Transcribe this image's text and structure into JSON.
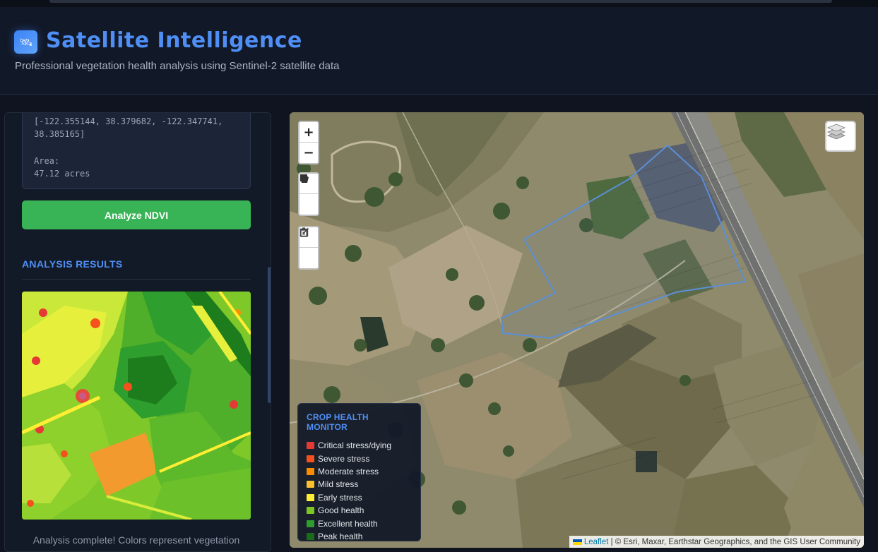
{
  "header": {
    "title": "Satellite Intelligence",
    "subtitle": "Professional vegetation health analysis using Sentinel-2 satellite data",
    "logo_icon": "satellite-icon"
  },
  "sidebar": {
    "bbox_text": "[-122.355144, 38.379682, -122.347741, 38.385165]",
    "area_label": "Area:",
    "area_value": "47.12 acres",
    "analyze_button": "Analyze NDVI",
    "results_title": "ANALYSIS RESULTS",
    "analysis_text": "Analysis complete! Colors represent vegetation"
  },
  "map": {
    "zoom_in": "+",
    "zoom_out": "−",
    "draw_tools": [
      "draw-polygon-icon",
      "draw-rectangle-icon",
      "edit-layers-icon",
      "delete-layers-icon"
    ],
    "layers_icon": "layers-icon",
    "attribution_link": "Leaflet",
    "attribution_text": "| © Esri, Maxar, Earthstar Geographics, and the GIS User Community"
  },
  "legend": {
    "title": "CROP HEALTH MONITOR",
    "items": [
      {
        "label": "Critical stress/dying",
        "color": "#e53935"
      },
      {
        "label": "Severe stress",
        "color": "#f4511e"
      },
      {
        "label": "Moderate stress",
        "color": "#fb8c00"
      },
      {
        "label": "Mild stress",
        "color": "#fbc02d"
      },
      {
        "label": "Early stress",
        "color": "#ffee33"
      },
      {
        "label": "Good health",
        "color": "#7cc623"
      },
      {
        "label": "Excellent health",
        "color": "#2e9e2e"
      },
      {
        "label": "Peak health",
        "color": "#1b6b1b"
      }
    ]
  },
  "colors": {
    "accent": "#4f8ff5",
    "button": "#38b356",
    "background": "#0f1420"
  }
}
